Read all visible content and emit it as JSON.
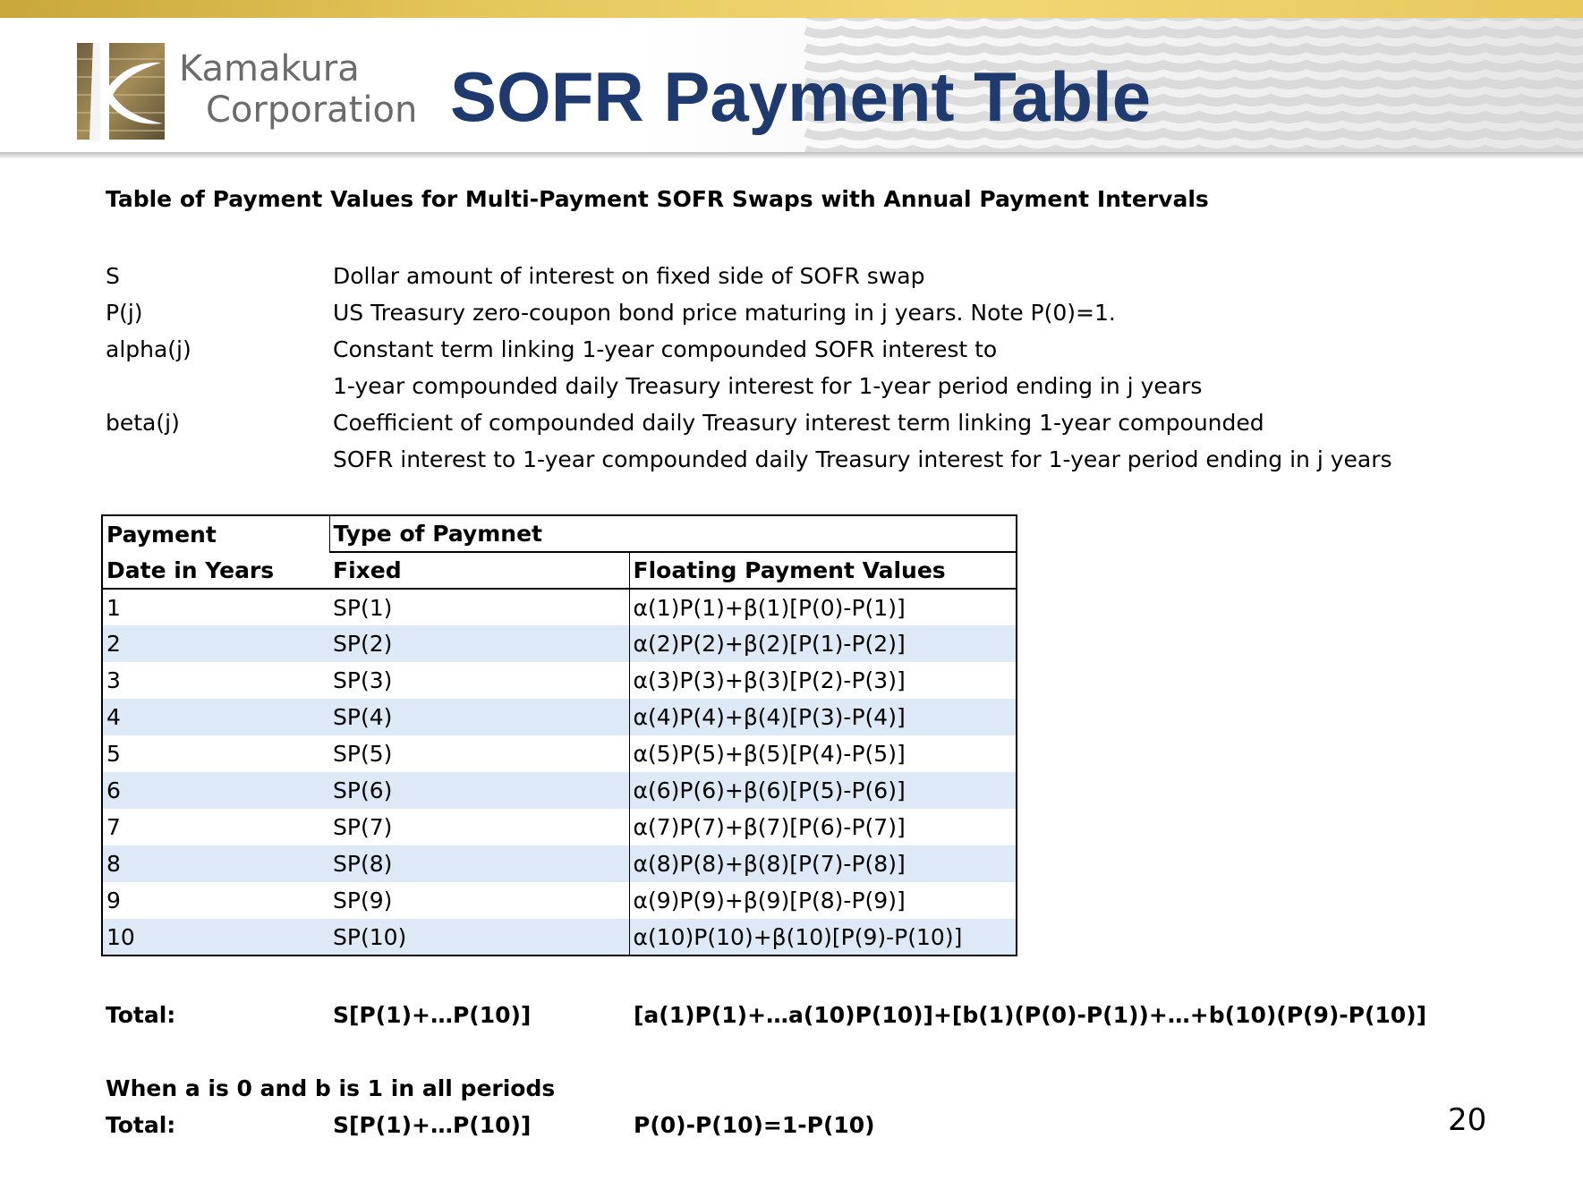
{
  "header": {
    "logo_line1": "Kamakura",
    "logo_line2": "Corporation",
    "title": "SOFR Payment Table"
  },
  "subtitle": "Table of Payment Values for Multi-Payment SOFR Swaps with Annual Payment Intervals",
  "definitions": [
    {
      "term": "S",
      "desc": "Dollar amount of interest on fixed side of SOFR swap"
    },
    {
      "term": "P(j)",
      "desc": "US Treasury zero-coupon bond price maturing in j years.  Note P(0)=1."
    },
    {
      "term": "alpha(j)",
      "desc": "Constant term linking 1-year compounded SOFR interest to"
    },
    {
      "term": "",
      "desc": "1-year compounded daily Treasury interest for 1-year period ending in j years"
    },
    {
      "term": "beta(j)",
      "desc": "Coefficient of compounded daily Treasury interest term linking 1-year compounded"
    },
    {
      "term": "",
      "desc": "SOFR interest to 1-year compounded daily Treasury interest for 1-year period ending in j years"
    }
  ],
  "table": {
    "header_row1": [
      "Payment",
      "Type of Paymnet"
    ],
    "header_row2": [
      "Date in Years",
      "Fixed",
      "Floating Payment Values"
    ],
    "rows": [
      [
        "1",
        "SP(1)",
        "α(1)P(1)+β(1)[P(0)-P(1)]"
      ],
      [
        "2",
        "SP(2)",
        "α(2)P(2)+β(2)[P(1)-P(2)]"
      ],
      [
        "3",
        "SP(3)",
        "α(3)P(3)+β(3)[P(2)-P(3)]"
      ],
      [
        "4",
        "SP(4)",
        "α(4)P(4)+β(4)[P(3)-P(4)]"
      ],
      [
        "5",
        "SP(5)",
        "α(5)P(5)+β(5)[P(4)-P(5)]"
      ],
      [
        "6",
        "SP(6)",
        "α(6)P(6)+β(6)[P(5)-P(6)]"
      ],
      [
        "7",
        "SP(7)",
        "α(7)P(7)+β(7)[P(6)-P(7)]"
      ],
      [
        "8",
        "SP(8)",
        "α(8)P(8)+β(8)[P(7)-P(8)]"
      ],
      [
        "9",
        "SP(9)",
        "α(9)P(9)+β(9)[P(8)-P(9)]"
      ],
      [
        "10",
        "SP(10)",
        "α(10)P(10)+β(10)[P(9)-P(10)]"
      ]
    ]
  },
  "total1": {
    "label": "Total:",
    "fixed": "S[P(1)+…P(10)]",
    "floating": "[a(1)P(1)+…a(10)P(10)]+[b(1)(P(0)-P(1))+…+b(10)(P(9)-P(10)]"
  },
  "condition": "When a is 0 and b is 1 in all periods",
  "total2": {
    "label": "Total:",
    "fixed": "S[P(1)+…P(10)]",
    "floating": "P(0)-P(10)=1-P(10)"
  },
  "page_number": "20",
  "colors": {
    "title": "#1f3a6e",
    "gold_bar": "#e5c65a",
    "row_alt": "#dde9f6"
  }
}
